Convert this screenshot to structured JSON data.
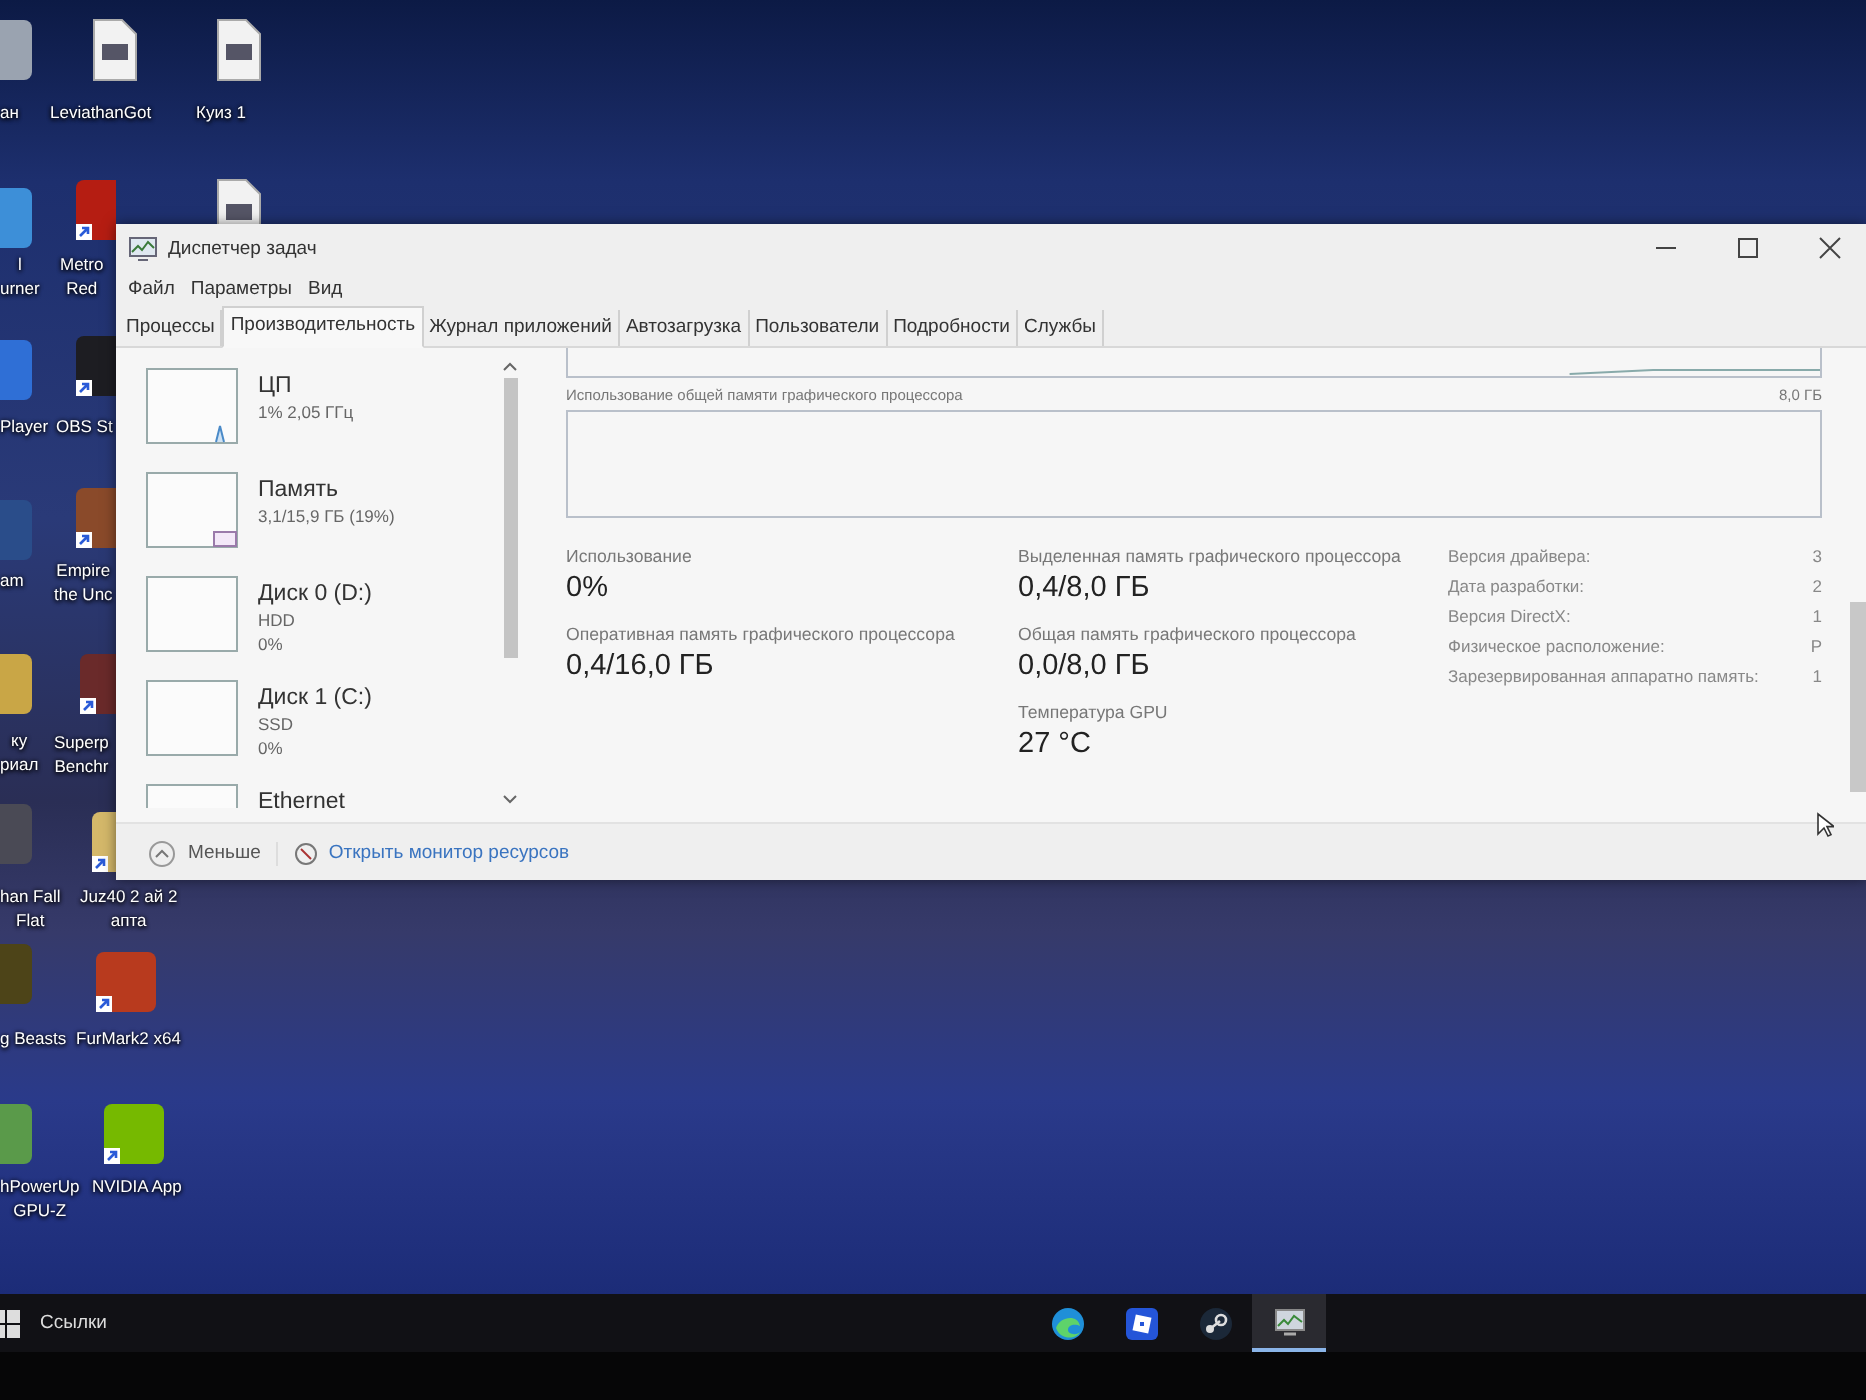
{
  "desktop": {
    "icons": [
      {
        "label": "ан"
      },
      {
        "label": "LeviathanGot"
      },
      {
        "label": "Куиз 1"
      },
      {
        "label": "l\nurner"
      },
      {
        "label": "Metro\nRed"
      },
      {
        "label": "Player"
      },
      {
        "label": "OBS St"
      },
      {
        "label": "am"
      },
      {
        "label": "Empire\nthe Unc"
      },
      {
        "label": "ку\nриал"
      },
      {
        "label": "Superp\nBenchr"
      },
      {
        "label": "han Fall\nFlat"
      },
      {
        "label": "Juz40 2 ай 2\nапта"
      },
      {
        "label": "g Beasts"
      },
      {
        "label": "FurMark2 x64"
      },
      {
        "label": "hPowerUp\nGPU-Z"
      },
      {
        "label": "NVIDIA App"
      }
    ]
  },
  "window": {
    "title": "Диспетчер задач",
    "menu": [
      "Файл",
      "Параметры",
      "Вид"
    ],
    "tabs": [
      {
        "label": "Процессы",
        "selected": false
      },
      {
        "label": "Производительность",
        "selected": true
      },
      {
        "label": "Журнал приложений",
        "selected": false
      },
      {
        "label": "Автозагрузка",
        "selected": false
      },
      {
        "label": "Пользователи",
        "selected": false
      },
      {
        "label": "Подробности",
        "selected": false
      },
      {
        "label": "Службы",
        "selected": false
      }
    ],
    "sidebar": {
      "items": [
        {
          "title": "ЦП",
          "details": [
            "1% 2,05 ГГц"
          ]
        },
        {
          "title": "Память",
          "details": [
            "3,1/15,9 ГБ (19%)"
          ]
        },
        {
          "title": "Диск 0 (D:)",
          "details": [
            "HDD",
            "0%"
          ]
        },
        {
          "title": "Диск 1 (C:)",
          "details": [
            "SSD",
            "0%"
          ]
        },
        {
          "title": "Ethernet"
        }
      ]
    },
    "graph": {
      "label": "Использование общей памяти графического процессора",
      "max": "8,0 ГБ"
    },
    "stat_columns": [
      [
        {
          "label": "Использование",
          "value": "0%"
        },
        {
          "label": "Оперативная память графического процессора",
          "value": "0,4/16,0 ГБ"
        }
      ],
      [
        {
          "label": "Выделенная память графического процессора",
          "value": "0,4/8,0 ГБ"
        },
        {
          "label": "Общая память графического процессора",
          "value": "0,0/8,0 ГБ"
        },
        {
          "label": "Температура GPU",
          "value": "27 °C"
        }
      ]
    ],
    "properties": [
      {
        "label": "Версия драйвера:",
        "value": "3"
      },
      {
        "label": "Дата разработки:",
        "value": "2"
      },
      {
        "label": "Версия DirectX:",
        "value": "1"
      },
      {
        "label": "Физическое расположение:",
        "value": "Р"
      },
      {
        "label": "Зарезервированная аппаратно память:",
        "value": "1"
      }
    ],
    "footer": {
      "collapse": "Меньше",
      "link": "Открыть монитор ресурсов"
    }
  },
  "taskbar": {
    "links_label": "Ссылки",
    "apps": [
      {
        "selected": false
      },
      {
        "selected": false
      },
      {
        "selected": false
      },
      {
        "selected": true
      }
    ]
  }
}
